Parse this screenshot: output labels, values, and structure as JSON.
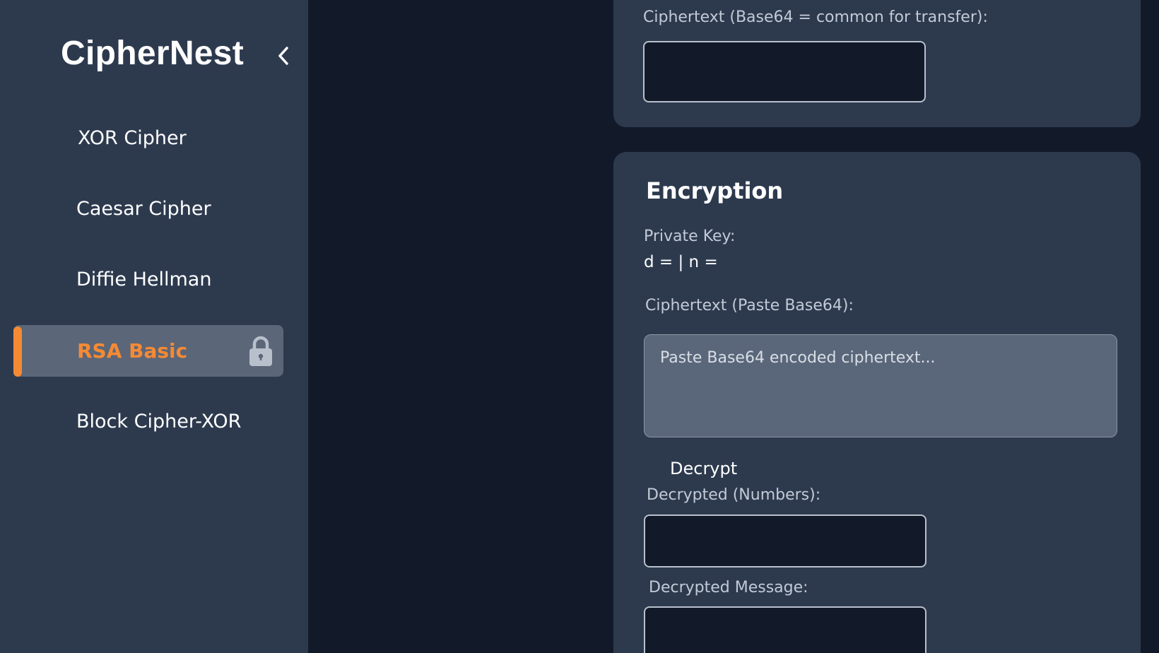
{
  "sidebar": {
    "brand": "CipherNest",
    "collapse_icon": "chevron-left-icon",
    "items": [
      {
        "label": "XOR Cipher"
      },
      {
        "label": "Caesar Cipher"
      },
      {
        "label": "Diffie Hellman"
      },
      {
        "label": "RSA Basic",
        "active": true,
        "icon": "lock-icon"
      },
      {
        "label": "Block Cipher-XOR"
      }
    ]
  },
  "top_card": {
    "ciphertext_label": "Ciphertext (Base64 = common for transfer):",
    "ciphertext_value": ""
  },
  "encryption": {
    "title": "Encryption",
    "private_key_label": "Private Key:",
    "private_key_value": "d = | n =",
    "ciphertext_label": "Ciphertext (Paste Base64):",
    "ciphertext_placeholder": "Paste Base64 encoded ciphertext...",
    "decrypt_label": "Decrypt",
    "decrypted_numbers_label": "Decrypted (Numbers):",
    "decrypted_numbers_value": "",
    "decrypted_message_label": "Decrypted Message:",
    "decrypted_message_value": ""
  },
  "colors": {
    "sidebar_bg": "#2d3a4e",
    "main_bg": "#121a2a",
    "accent": "#f58a35",
    "active_item_bg": "#5b6678",
    "card_bg": "#2d3a4e"
  }
}
